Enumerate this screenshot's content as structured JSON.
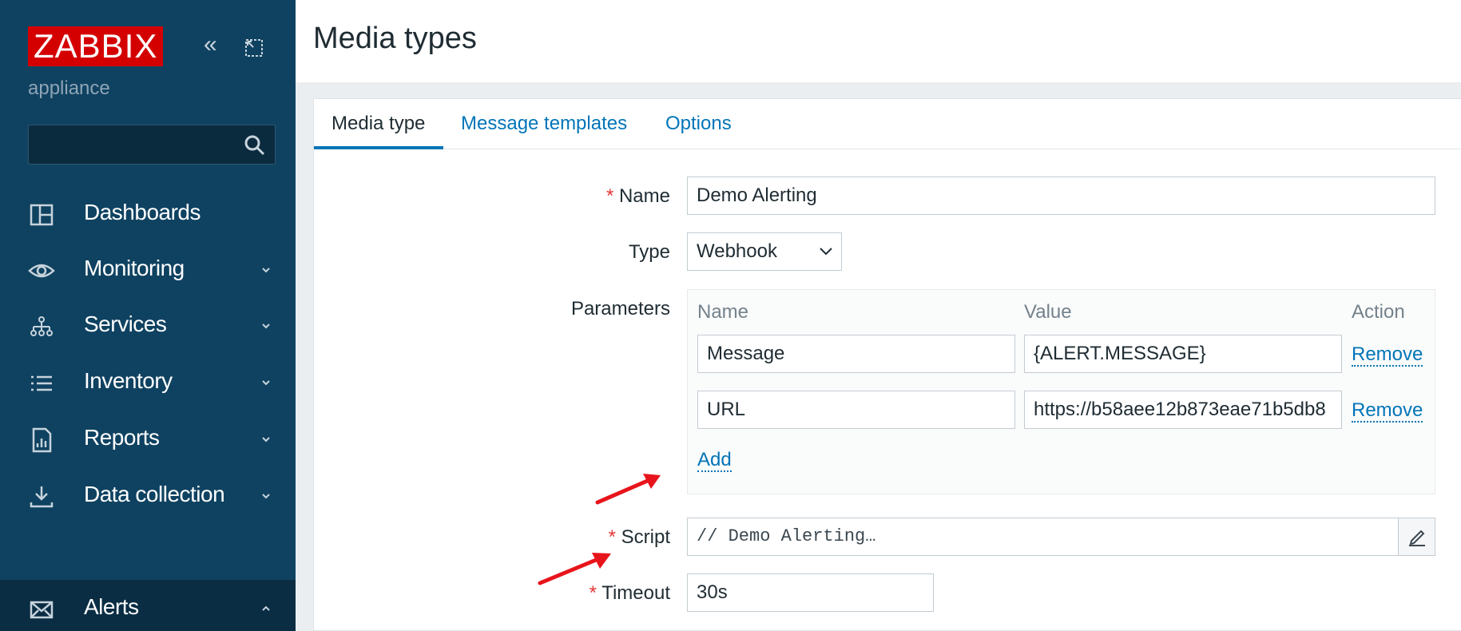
{
  "sidebar": {
    "logo": "ZABBIX",
    "subtitle": "appliance",
    "collapse_glyph": "«",
    "search": {
      "placeholder": "",
      "icon": "search-icon"
    },
    "items": [
      {
        "label": "Dashboards",
        "icon": "dashboards-icon",
        "has_chevron": false,
        "chevron": ""
      },
      {
        "label": "Monitoring",
        "icon": "eye-icon",
        "has_chevron": true,
        "chevron": "down"
      },
      {
        "label": "Services",
        "icon": "services-hierarchy-icon",
        "has_chevron": true,
        "chevron": "down"
      },
      {
        "label": "Inventory",
        "icon": "list-icon",
        "has_chevron": true,
        "chevron": "down"
      },
      {
        "label": "Reports",
        "icon": "report-icon",
        "has_chevron": true,
        "chevron": "down"
      },
      {
        "label": "Data collection",
        "icon": "download-icon",
        "has_chevron": true,
        "chevron": "down"
      },
      {
        "label": "Alerts",
        "icon": "envelope-icon",
        "has_chevron": true,
        "chevron": "up",
        "active": true
      }
    ]
  },
  "header": {
    "title": "Media types"
  },
  "tabs": [
    {
      "label": "Media type",
      "active": true
    },
    {
      "label": "Message templates",
      "active": false
    },
    {
      "label": "Options",
      "active": false
    }
  ],
  "form": {
    "name": {
      "required_mark": "*",
      "label": "Name",
      "value": "Demo Alerting"
    },
    "type": {
      "label": "Type",
      "value": "Webhook"
    },
    "parameters": {
      "label": "Parameters",
      "columns": [
        "Name",
        "Value",
        "Action"
      ],
      "rows": [
        {
          "name": "Message",
          "value": "{ALERT.MESSAGE}",
          "action": "Remove"
        },
        {
          "name": "URL",
          "value": "https://b58aee12b873eae71b5db8",
          "action": "Remove"
        }
      ],
      "add_label": "Add"
    },
    "script": {
      "required_mark": "*",
      "label": "Script",
      "value": "// Demo Alerting…"
    },
    "timeout": {
      "required_mark": "*",
      "label": "Timeout",
      "value": "30s"
    }
  },
  "colors": {
    "sidebar_bg": "#0f4261",
    "logo_bg": "#d40000",
    "link": "#0275b8",
    "required": "#e33734",
    "annotation_arrow": "#e8141b"
  }
}
